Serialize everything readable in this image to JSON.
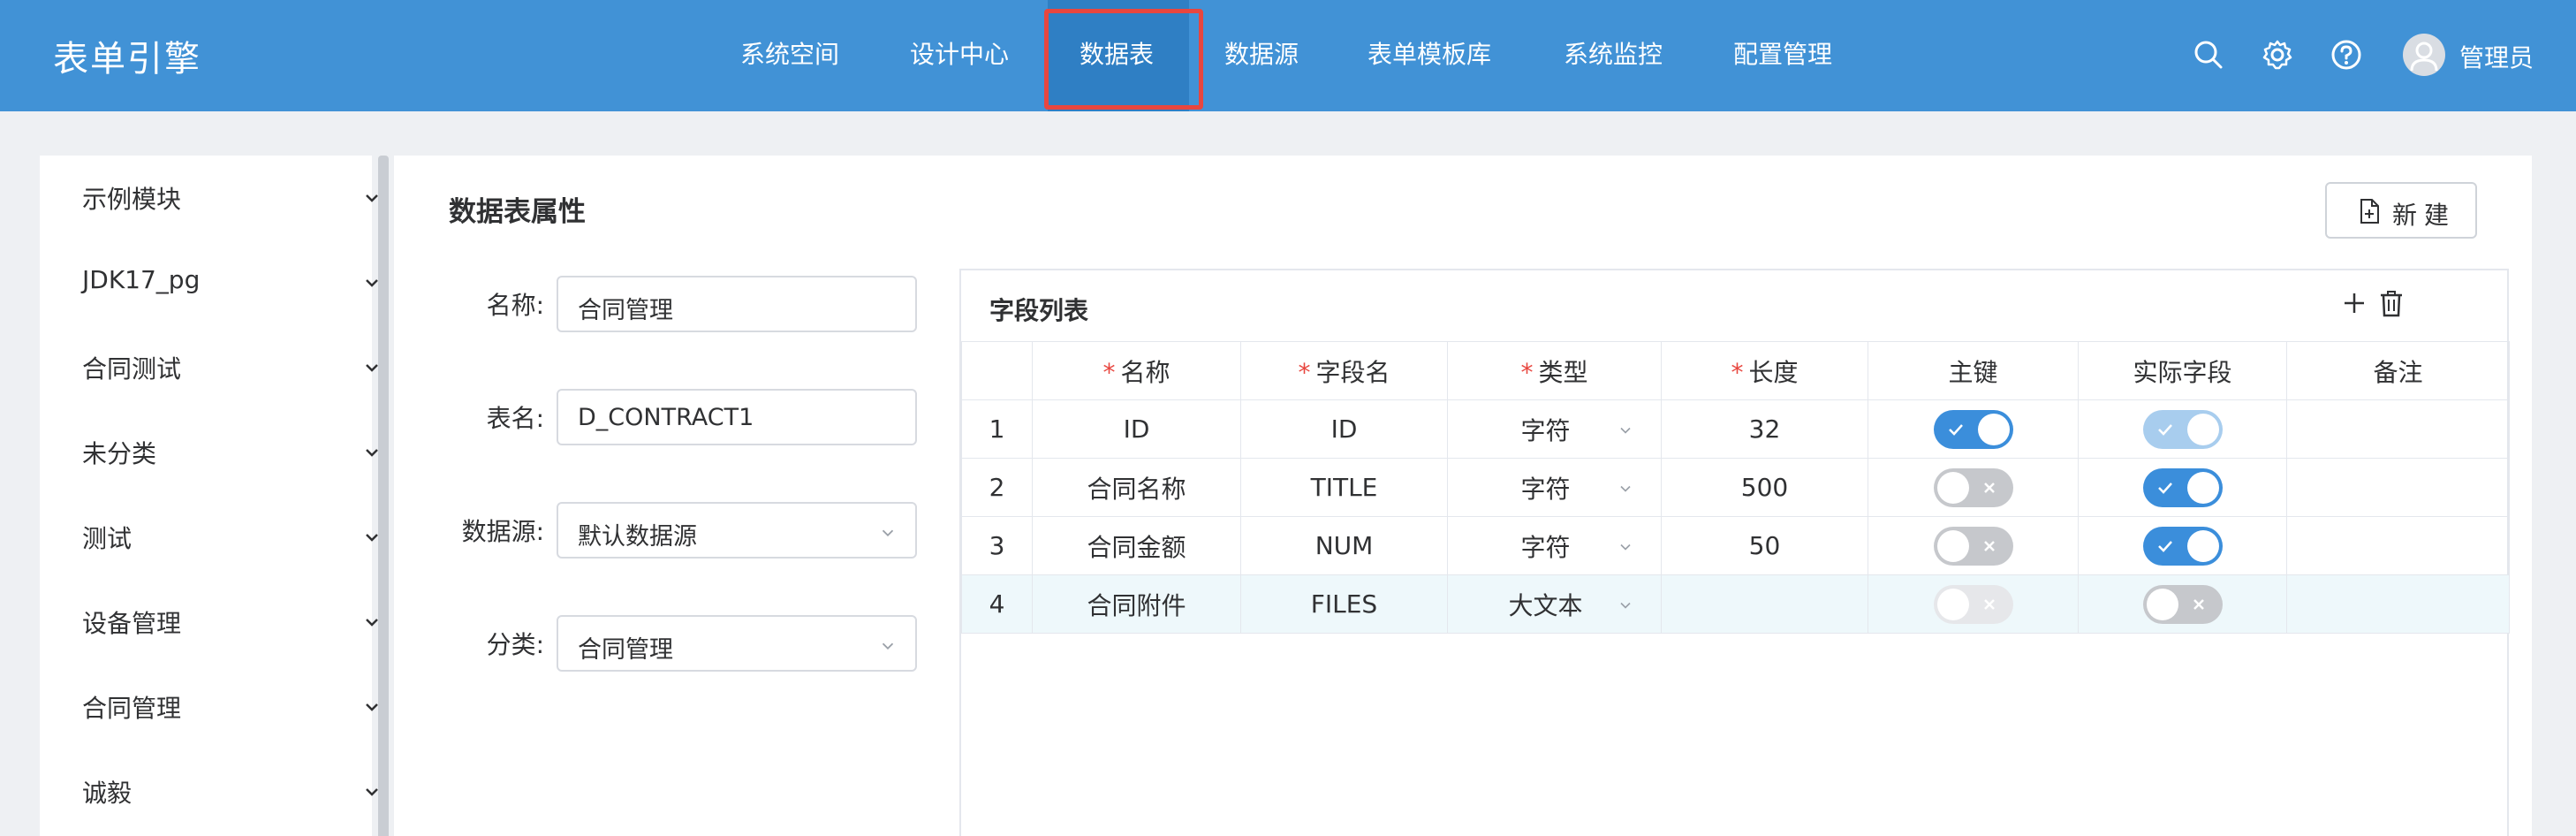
{
  "app": {
    "title": "表单引擎"
  },
  "nav": {
    "items": [
      {
        "label": "系统空间"
      },
      {
        "label": "设计中心"
      },
      {
        "label": "数据表",
        "active": true
      },
      {
        "label": "数据源"
      },
      {
        "label": "表单模板库"
      },
      {
        "label": "系统监控"
      },
      {
        "label": "配置管理"
      }
    ]
  },
  "user": {
    "name": "管理员"
  },
  "icons": {
    "search": "search-icon",
    "settings": "gear-icon",
    "help": "help-icon",
    "avatar": "user-avatar-icon"
  },
  "colors": {
    "primary": "#4192d6",
    "highlight_border": "#e8463f",
    "switch_on": "#3b8edb"
  },
  "sidebar": {
    "items": [
      {
        "label": "示例模块"
      },
      {
        "label": "JDK17_pg"
      },
      {
        "label": "合同测试"
      },
      {
        "label": "未分类"
      },
      {
        "label": "测试"
      },
      {
        "label": "设备管理"
      },
      {
        "label": "合同管理"
      },
      {
        "label": "诚毅"
      }
    ]
  },
  "panel": {
    "title": "数据表属性",
    "new_button": "新建"
  },
  "form": {
    "name_label": "名称:",
    "name_value": "合同管理",
    "table_label": "表名:",
    "table_value": "D_CONTRACT1",
    "datasource_label": "数据源:",
    "datasource_value": "默认数据源",
    "category_label": "分类:",
    "category_value": "合同管理"
  },
  "fields": {
    "title": "字段列表",
    "headers": {
      "name": "名称",
      "field": "字段名",
      "type": "类型",
      "length": "长度",
      "pk": "主键",
      "actual": "实际字段",
      "remark": "备注"
    },
    "rows": [
      {
        "no": "1",
        "name": "ID",
        "field": "ID",
        "type": "字符",
        "length": "32",
        "pk": "on",
        "actual": "on-disabled",
        "remark": ""
      },
      {
        "no": "2",
        "name": "合同名称",
        "field": "TITLE",
        "type": "字符",
        "length": "500",
        "pk": "off",
        "actual": "on",
        "remark": ""
      },
      {
        "no": "3",
        "name": "合同金额",
        "field": "NUM",
        "type": "字符",
        "length": "50",
        "pk": "off",
        "actual": "on",
        "remark": ""
      },
      {
        "no": "4",
        "name": "合同附件",
        "field": "FILES",
        "type": "大文本",
        "length": "",
        "pk": "off-disabled",
        "actual": "off",
        "remark": ""
      }
    ]
  }
}
